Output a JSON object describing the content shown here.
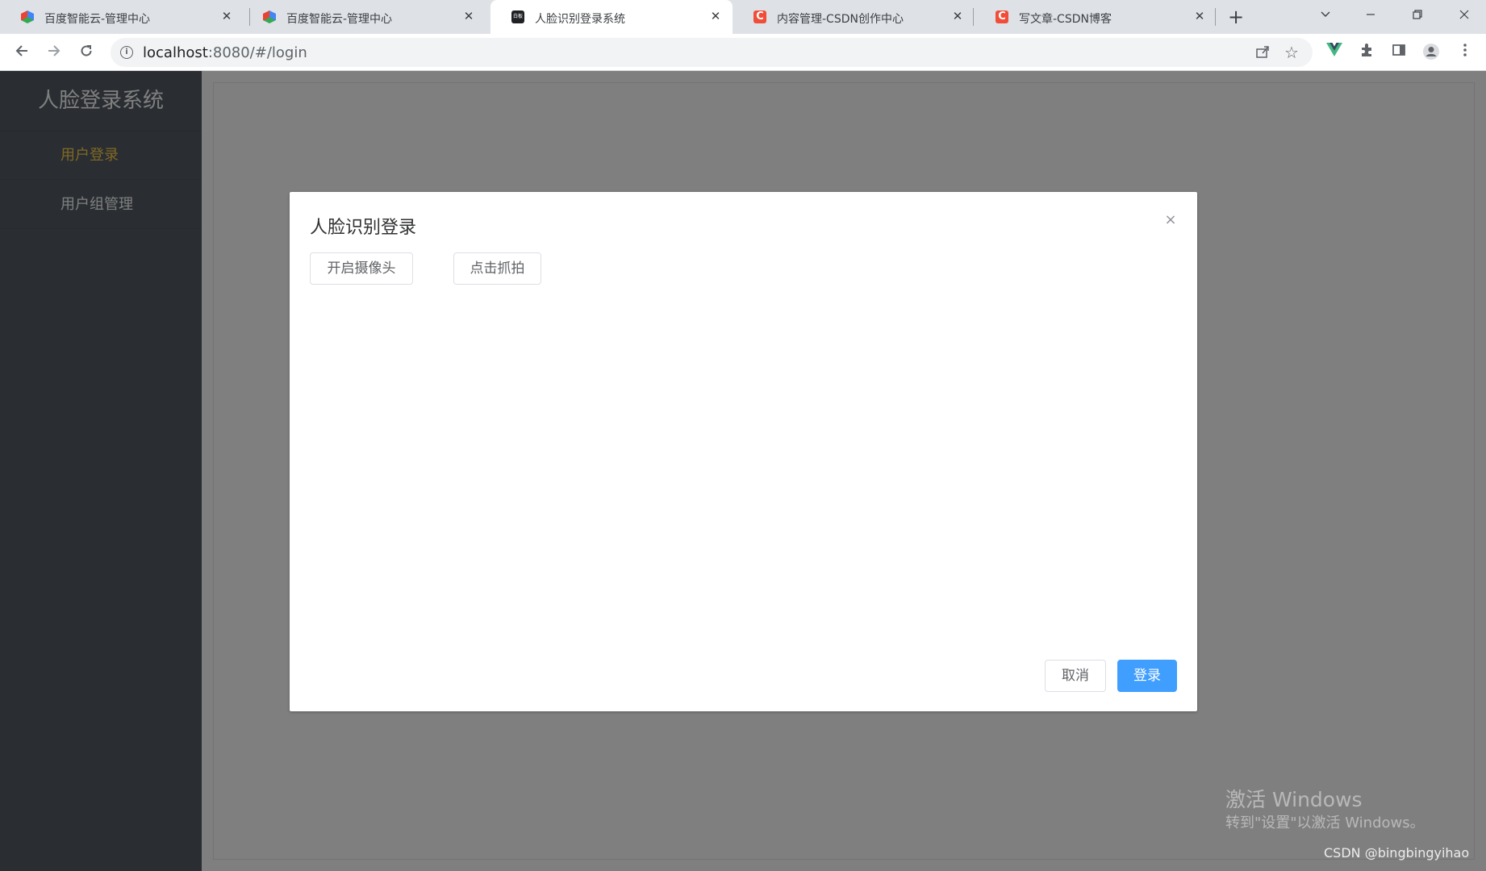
{
  "browser": {
    "tabs": [
      {
        "title": "百度智能云-管理中心",
        "favicon": "baidu-cloud-icon",
        "active": false
      },
      {
        "title": "百度智能云-管理中心",
        "favicon": "baidu-cloud-icon",
        "active": false
      },
      {
        "title": "人脸识别登录系统",
        "favicon": "face-app-icon",
        "favicon_text": "白板",
        "active": true
      },
      {
        "title": "内容管理-CSDN创作中心",
        "favicon": "csdn-icon",
        "favicon_text": "C",
        "active": false
      },
      {
        "title": "写文章-CSDN博客",
        "favicon": "csdn-icon",
        "favicon_text": "C",
        "active": false
      }
    ],
    "tab_close_glyph": "✕",
    "new_tab_glyph": "+",
    "address": {
      "host": "localhost",
      "path": ":8080/#/login"
    }
  },
  "sidebar": {
    "brand": "人脸登录系统",
    "items": [
      {
        "label": "用户登录",
        "active": true
      },
      {
        "label": "用户组管理",
        "active": false
      }
    ],
    "bg_color": "#545c64",
    "active_color": "#ffd04b"
  },
  "dialog": {
    "title": "人脸识别登录",
    "open_camera_label": "开启摄像头",
    "capture_label": "点击抓拍",
    "cancel_label": "取消",
    "login_label": "登录",
    "close_glyph": "×",
    "primary_color": "#409eff"
  },
  "overlay": {
    "activation_title": "激活 Windows",
    "activation_subtitle": "转到\"设置\"以激活 Windows。",
    "credit": "CSDN @bingbingyihao"
  }
}
